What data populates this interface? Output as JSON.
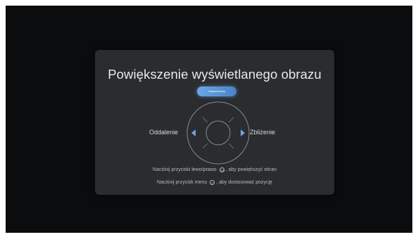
{
  "dialog": {
    "title": "Powiększenie wyświetlanego obrazu",
    "mode_button_label": "Zaawansowany"
  },
  "control": {
    "left_label": "Oddalenie",
    "right_label": "Zbliżenie"
  },
  "hints": {
    "line1_before": "Naciśnij przyciski lewo/prawo",
    "line1_icon": "ok-button-icon",
    "line1_after": ", aby powiększyć ekran",
    "line2_before": "Naciśnij przycisk menu",
    "line2_icon": "menu-button-icon",
    "line2_after": ", aby dostosować pozycję"
  },
  "colors": {
    "accent": "#5b92d6",
    "dialog_bg": "#2a2c30",
    "screen_bg": "#0b0c0e"
  }
}
